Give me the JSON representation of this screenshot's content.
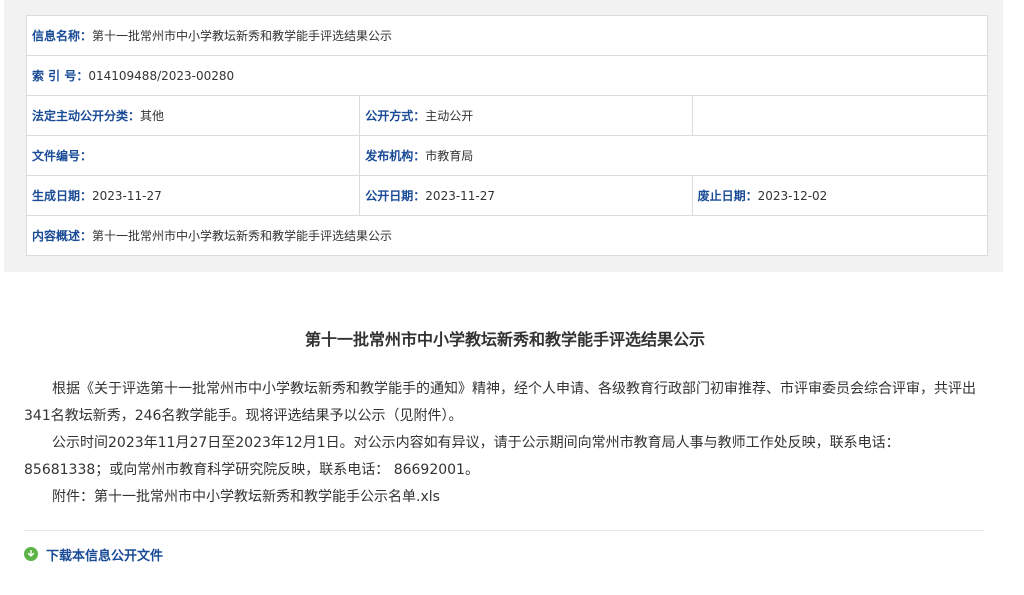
{
  "meta": {
    "info_name": {
      "label": "信息名称：",
      "value": "第十一批常州市中小学教坛新秀和教学能手评选结果公示"
    },
    "index_no": {
      "label": "索 引 号：",
      "value": "014109488/2023-00280"
    },
    "category": {
      "label": "法定主动公开分类：",
      "value": "其他"
    },
    "publish_method": {
      "label": "公开方式：",
      "value": "主动公开"
    },
    "doc_no": {
      "label": "文件编号：",
      "value": ""
    },
    "issuer": {
      "label": "发布机构：",
      "value": "市教育局"
    },
    "created_date": {
      "label": "生成日期：",
      "value": "2023-11-27"
    },
    "publish_date": {
      "label": "公开日期：",
      "value": "2023-11-27"
    },
    "expire_date": {
      "label": "废止日期：",
      "value": "2023-12-02"
    },
    "summary": {
      "label": "内容概述：",
      "value": "第十一批常州市中小学教坛新秀和教学能手评选结果公示"
    }
  },
  "article": {
    "title": "第十一批常州市中小学教坛新秀和教学能手评选结果公示",
    "paragraphs": [
      "根据《关于评选第十一批常州市中小学教坛新秀和教学能手的通知》精神，经个人申请、各级教育行政部门初审推荐、市评审委员会综合评审，共评出341名教坛新秀，246名教学能手。现将评选结果予以公示（见附件）。",
      "公示时间2023年11月27日至2023年12月1日。对公示内容如有异议，请于公示期间向常州市教育局人事与教师工作处反映，联系电话：85681338；或向常州市教育科学研究院反映，联系电话： 86692001。",
      "附件：第十一批常州市中小学教坛新秀和教学能手公示名单.xls"
    ]
  },
  "download": {
    "label": "下载本信息公开文件",
    "icon": "download-circle-icon",
    "icon_color": "#5db346"
  },
  "colors": {
    "label": "#1a4b96",
    "text": "#333333",
    "border": "#dcdcdc",
    "panel_bg": "#f2f2f2"
  }
}
